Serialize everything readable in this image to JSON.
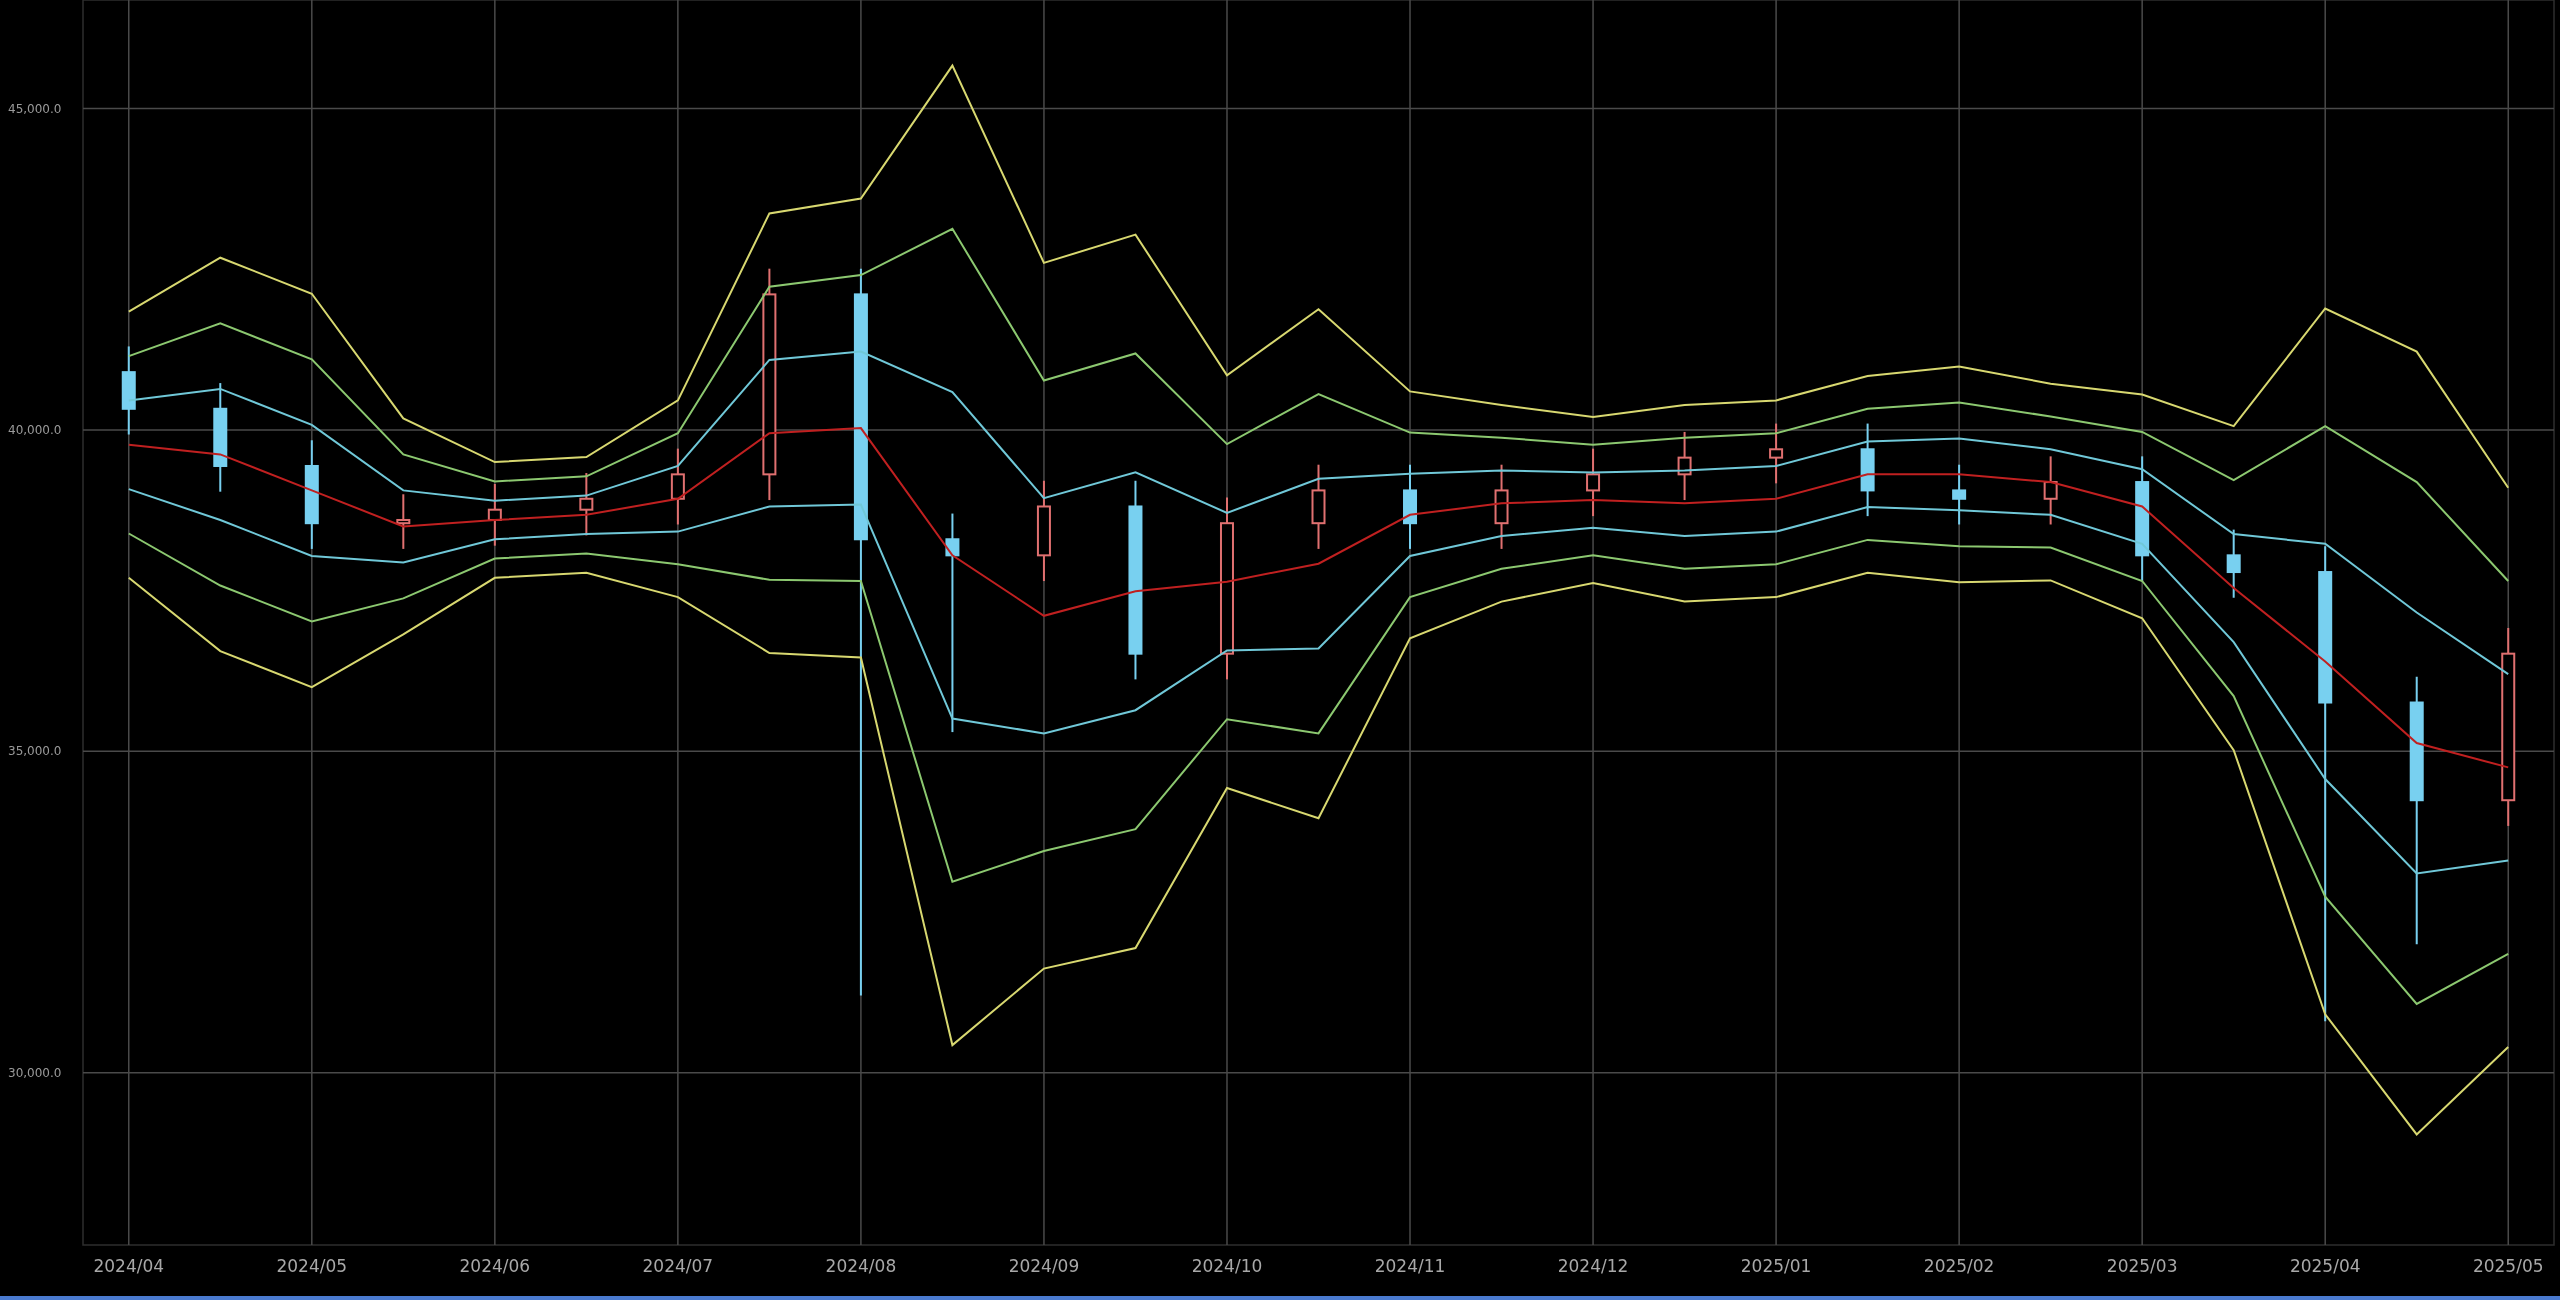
{
  "chart": {
    "chart_data": {
      "type": "candlestick",
      "categories": [
        "2024/04",
        null,
        "2024/05",
        null,
        "2024/06",
        null,
        "2024/07",
        null,
        "2024/08",
        null,
        "2024/09",
        null,
        "2024/10",
        null,
        "2024/11",
        null,
        "2024/12",
        null,
        "2025/01",
        null,
        "2025/02",
        null,
        "2025/03",
        null,
        "2025/04",
        null,
        "2025/05"
      ],
      "grid": true,
      "ylim": [
        27320,
        46690
      ],
      "yticks": [
        {
          "value": 30000,
          "label": "30,000.0"
        },
        {
          "value": 35000,
          "label": "35,000.0"
        },
        {
          "value": 40000,
          "label": "40,000.0"
        },
        {
          "value": 45000,
          "label": "45,000.0"
        }
      ],
      "ohlc": [
        [
          40900,
          41300,
          39930,
          40330
        ],
        [
          40330,
          40730,
          39040,
          39440
        ],
        [
          39440,
          39840,
          38150,
          38550
        ],
        [
          38550,
          39000,
          38150,
          38600
        ],
        [
          38600,
          39160,
          38200,
          38760
        ],
        [
          38760,
          39330,
          38360,
          38930
        ],
        [
          38930,
          39710,
          38530,
          39310
        ],
        [
          39310,
          42510,
          38910,
          42110
        ],
        [
          42110,
          42510,
          31200,
          38300
        ],
        [
          38300,
          38700,
          35300,
          38050
        ],
        [
          38050,
          39210,
          37650,
          38810
        ],
        [
          38810,
          39210,
          36120,
          36520
        ],
        [
          36520,
          38950,
          36120,
          38550
        ],
        [
          38550,
          39460,
          38150,
          39060
        ],
        [
          39060,
          39460,
          38150,
          38550
        ],
        [
          38550,
          39460,
          38150,
          39060
        ],
        [
          39060,
          39710,
          38660,
          39310
        ],
        [
          39310,
          39970,
          38910,
          39570
        ],
        [
          39570,
          40100,
          39170,
          39700
        ],
        [
          39700,
          40100,
          38660,
          39060
        ],
        [
          39060,
          39460,
          38530,
          38930
        ],
        [
          38930,
          39590,
          38530,
          39190
        ],
        [
          39190,
          39590,
          37650,
          38050
        ],
        [
          38050,
          38450,
          37390,
          37790
        ],
        [
          37790,
          38190,
          30800,
          35760
        ],
        [
          35760,
          36160,
          32000,
          34240
        ],
        [
          34240,
          36920,
          33840,
          36520
        ]
      ],
      "series": [
        {
          "type": "line",
          "color": "#d8d870",
          "values": [
            41840,
            42680,
            42120,
            40180,
            39500,
            39580,
            40460,
            43370,
            43600,
            45670,
            42600,
            43040,
            40850,
            41880,
            40600,
            40390,
            40200,
            40390,
            40460,
            40840,
            40990,
            40720,
            40550,
            40060,
            41890,
            41220,
            39100
          ]
        },
        {
          "type": "line",
          "color": "#8cc870",
          "values": [
            41150,
            41660,
            41100,
            39620,
            39200,
            39280,
            39950,
            42230,
            42410,
            43130,
            40770,
            41190,
            39780,
            40560,
            39960,
            39880,
            39770,
            39880,
            39950,
            40330,
            40430,
            40210,
            39970,
            39220,
            40060,
            39190,
            37650
          ]
        },
        {
          "type": "line",
          "color": "#70c8d8",
          "values": [
            40460,
            40640,
            40080,
            39060,
            38900,
            38980,
            39440,
            41090,
            41220,
            40590,
            38940,
            39340,
            38710,
            39240,
            39320,
            39370,
            39340,
            39370,
            39440,
            39820,
            39870,
            39700,
            39390,
            38380,
            38230,
            37160,
            36200
          ]
        },
        {
          "type": "line",
          "color": "#c02020",
          "values": [
            39770,
            39620,
            39060,
            38500,
            38600,
            38680,
            38930,
            39950,
            40030,
            38050,
            37110,
            37490,
            37640,
            37920,
            38680,
            38860,
            38910,
            38860,
            38930,
            39310,
            39310,
            39190,
            38810,
            37540,
            36400,
            35130,
            34750
          ]
        },
        {
          "type": "line",
          "color": "#70c8d8",
          "values": [
            39080,
            38600,
            38040,
            37940,
            38300,
            38380,
            38420,
            38810,
            38840,
            35510,
            35280,
            35640,
            36570,
            36600,
            38040,
            38350,
            38480,
            38350,
            38420,
            38800,
            38750,
            38680,
            38230,
            36700,
            34570,
            33100,
            33300
          ]
        },
        {
          "type": "line",
          "color": "#8cc870",
          "values": [
            38390,
            37580,
            37020,
            37380,
            38000,
            38080,
            37910,
            37670,
            37650,
            32970,
            33450,
            33790,
            35500,
            35280,
            37400,
            37840,
            38050,
            37840,
            37910,
            38290,
            38190,
            38170,
            37650,
            35860,
            32740,
            31070,
            31850
          ]
        },
        {
          "type": "line",
          "color": "#d8d870",
          "values": [
            37700,
            36560,
            36000,
            36820,
            37700,
            37780,
            37400,
            36530,
            36460,
            30430,
            31620,
            31940,
            34430,
            33960,
            36760,
            37330,
            37620,
            37330,
            37400,
            37780,
            37630,
            37660,
            37070,
            35020,
            30910,
            29040,
            30400
          ]
        }
      ]
    }
  }
}
